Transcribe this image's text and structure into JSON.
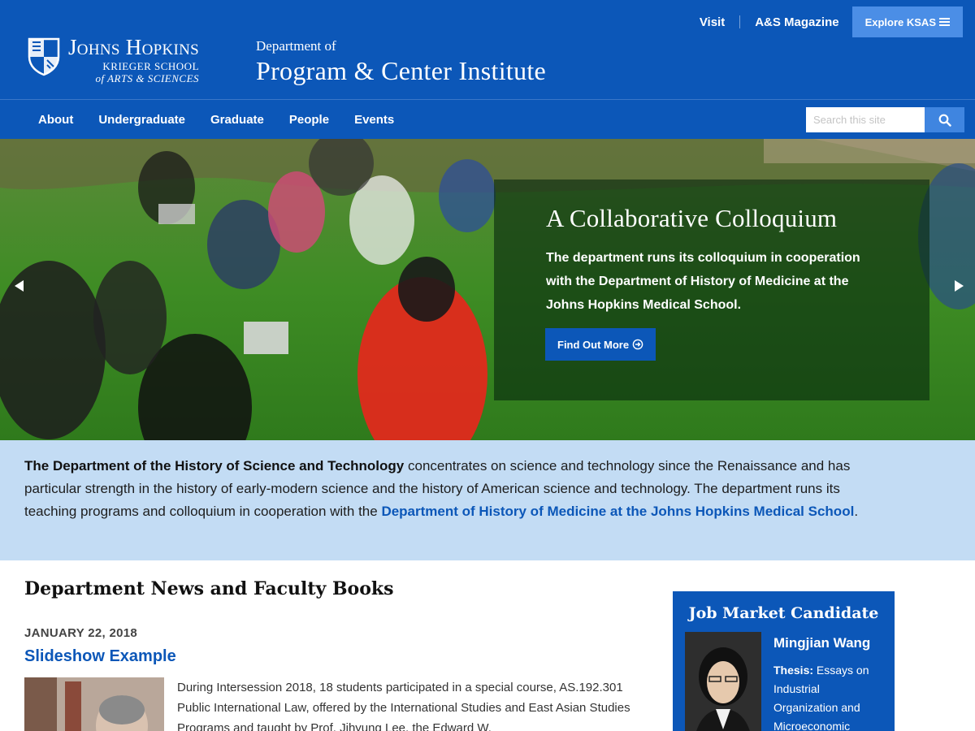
{
  "brand": {
    "logo_main": "Johns Hopkins",
    "logo_sub1": "KRIEGER SCHOOL",
    "logo_sub2": "of ARTS & SCIENCES"
  },
  "department": {
    "prefix": "Department of",
    "name": "Program & Center Institute"
  },
  "utility": {
    "visit": "Visit",
    "magazine": "A&S Magazine",
    "explore": "Explore KSAS"
  },
  "nav": {
    "items": [
      "About",
      "Undergraduate",
      "Graduate",
      "People",
      "Events"
    ]
  },
  "search": {
    "placeholder": "Search this site"
  },
  "hero": {
    "title": "A Collaborative Colloquium",
    "text": "The department runs its colloquium in cooperation with the Department of History of Medicine at the Johns Hopkins Medical School.",
    "button": "Find Out More"
  },
  "intro": {
    "strong": "The Department of the History of Science and Technology",
    "text": " concentrates on science and technology since the Renaissance and has particular strength in the history of early-modern science and the history of American science and technology. The department runs its teaching programs and colloquium in cooperation with the ",
    "link": "Department of History of Medicine at the Johns Hopkins Medical School",
    "end": "."
  },
  "news": {
    "title": "Department News and Faculty Books",
    "date": "JANUARY 22, 2018",
    "headline": "Slideshow Example",
    "body": "During Intersession 2018, 18 students participated in a special course, AS.192.301 Public International Law, offered by the International Studies and East Asian Studies Programs and taught by Prof. Jihyung Lee, the Edward W."
  },
  "card": {
    "title": "Job Market Candidate",
    "name": "Mingjian Wang",
    "thesis_label": "Thesis:",
    "thesis_text": " Essays on Industrial Organization and Microeconomic"
  },
  "colors": {
    "brand_blue": "#0c57b8",
    "light_blue": "#c3dcf4",
    "button_blue": "#4b8ee6"
  }
}
